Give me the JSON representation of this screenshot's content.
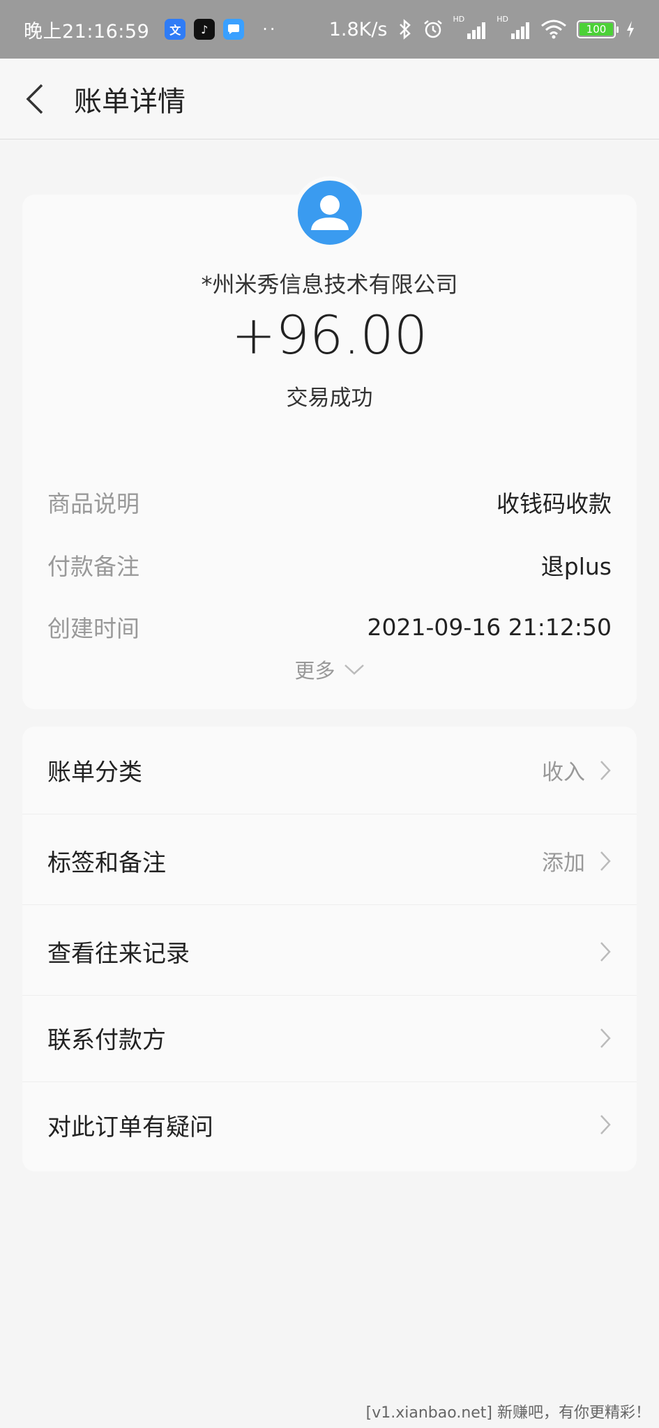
{
  "status_bar": {
    "time": "晚上21:16:59",
    "network_speed": "1.8K/s",
    "hd1": "HD",
    "hd2": "HD",
    "battery": "100",
    "more_dots": "··"
  },
  "header": {
    "title": "账单详情"
  },
  "transaction": {
    "payee": "*州米秀信息技术有限公司",
    "amount": "+96.00",
    "status": "交易成功",
    "details": [
      {
        "label": "商品说明",
        "value": "收钱码收款"
      },
      {
        "label": "付款备注",
        "value": "退plus"
      },
      {
        "label": "创建时间",
        "value": "2021-09-16 21:12:50"
      }
    ],
    "more_label": "更多"
  },
  "menu": {
    "items": [
      {
        "label": "账单分类",
        "value": "收入"
      },
      {
        "label": "标签和备注",
        "value": "添加"
      },
      {
        "label": "查看往来记录",
        "value": ""
      },
      {
        "label": "联系付款方",
        "value": ""
      },
      {
        "label": "对此订单有疑问",
        "value": ""
      }
    ]
  },
  "watermark": "[v1.xianbao.net] 新赚吧，有你更精彩！",
  "colors": {
    "avatar_bg": "#3a9bf0",
    "status_bar_bg": "#9b9b9b",
    "battery": "#4cd137"
  }
}
